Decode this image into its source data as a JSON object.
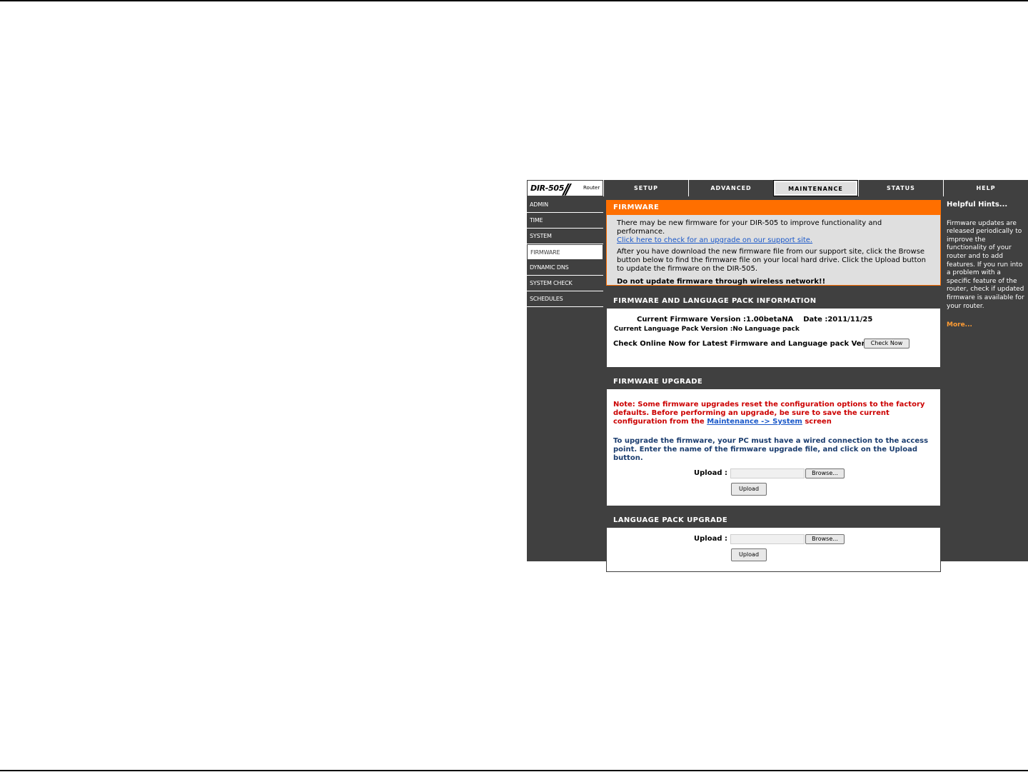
{
  "logo": {
    "model": "DIR-505",
    "sub": "Router"
  },
  "tabs": [
    {
      "label": "SETUP"
    },
    {
      "label": "ADVANCED"
    },
    {
      "label": "MAINTENANCE"
    },
    {
      "label": "STATUS"
    },
    {
      "label": "HELP"
    }
  ],
  "nav": [
    {
      "label": "ADMIN"
    },
    {
      "label": "TIME"
    },
    {
      "label": "SYSTEM"
    },
    {
      "label": "FIRMWARE"
    },
    {
      "label": "DYNAMIC DNS"
    },
    {
      "label": "SYSTEM CHECK"
    },
    {
      "label": "SCHEDULES"
    }
  ],
  "firmware": {
    "title": "FIRMWARE",
    "line1": "There may be new firmware for your DIR-505 to improve functionality and performance.",
    "link": "Click here to check for an upgrade on our support site.",
    "line2": "After you have download the new firmware file from our support site, click the Browse button below to find the firmware file on your local hard drive. Click the Upload button to update the firmware on the DIR-505.",
    "warning": "Do not update firmware through wireless network!!"
  },
  "info": {
    "title": "FIRMWARE AND LANGUAGE PACK INFORMATION",
    "fw_version_label": "Current Firmware Version :",
    "fw_version": "1.00betaNA",
    "date_label": "Date :",
    "date": "2011/11/25",
    "lang_label": "Current Language Pack Version :",
    "lang_value": "No Language pack",
    "check_label": "Check Online Now for Latest Firmware and Language pack Version :",
    "check_button": "Check Now"
  },
  "upgrade": {
    "title": "FIRMWARE UPGRADE",
    "note_prefix": "Note: Some firmware upgrades reset the configuration options to the factory defaults. Before performing an upgrade, be sure to save the current configuration from the ",
    "note_link": "Maintenance -> System",
    "note_suffix": " screen",
    "instruction": "To upgrade the firmware, your PC must have a wired connection to the access point. Enter the name of the firmware upgrade file, and click on the Upload button.",
    "upload_label": "Upload :",
    "browse_button": "Browse...",
    "upload_button": "Upload"
  },
  "lang_upgrade": {
    "title": "LANGUAGE PACK UPGRADE",
    "upload_label": "Upload :",
    "browse_button": "Browse...",
    "upload_button": "Upload"
  },
  "help": {
    "title": "Helpful Hints...",
    "text": "Firmware updates are released periodically to improve the functionality of your router and to add features. If you run into a problem with a specific feature of the router, check if updated firmware is available for your router.",
    "more": "More..."
  },
  "colors": {
    "accent": "#ff6f00",
    "dark": "#404040",
    "note": "#cc0000",
    "link": "#1a58c9"
  }
}
